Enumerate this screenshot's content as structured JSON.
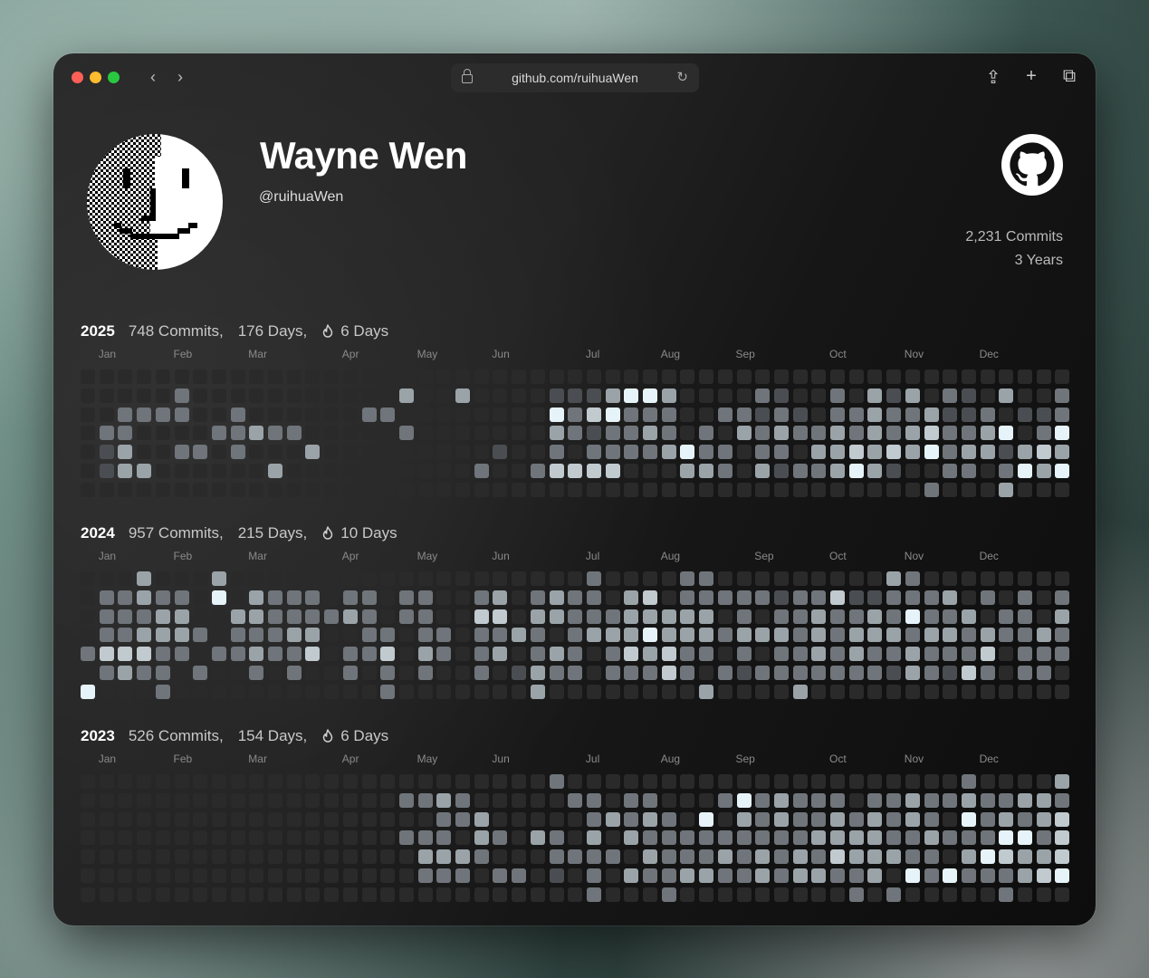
{
  "browser": {
    "url": "github.com/ruihuaWen",
    "back_icon": "chevron-left-icon",
    "forward_icon": "chevron-right-icon",
    "share_icon": "share-icon",
    "new_tab_icon": "plus-icon",
    "tabs_icon": "tabs-overview-icon"
  },
  "profile": {
    "name": "Wayne Wen",
    "handle": "@ruihuaWen",
    "commits_total": "2,231 Commits",
    "years": "3 Years"
  },
  "colors": {
    "level0": "#2a2a2a",
    "level1": "#4a4e52",
    "level2": "#6f757a",
    "level3": "#9aa3a8",
    "level4": "#c0cacf",
    "level5": "#e6f3f8"
  },
  "years": [
    {
      "year": "2025",
      "commits": "748 Commits,",
      "days": "176 Days,",
      "streak": "6 Days",
      "months": [
        "Jan",
        "Feb",
        "Mar",
        "Apr",
        "May",
        "Jun",
        "Jul",
        "Aug",
        "Sep",
        "Oct",
        "Nov",
        "Dec"
      ],
      "month_weeks": [
        1,
        5,
        9,
        14,
        18,
        22,
        27,
        31,
        35,
        40,
        44,
        48
      ],
      "levels": [
        "00000000000000000000000000000000000000000000000000000",
        "00000200000000000300300001113553000021002031302103002",
        "00222200200000022000000005245222002212102232231120112",
        "02200002232200000200000003212232020323223232342235025",
        "01300220200030000000001002022223522022033434352331343",
        "01330000003000000000020024444000332031223531002202535",
        "00000000000000000000000000000000000000000000020003000"
      ]
    },
    {
      "year": "2024",
      "commits": "957 Commits,",
      "days": "215 Days,",
      "streak": "10 Days",
      "months": [
        "Jan",
        "Feb",
        "Mar",
        "Apr",
        "May",
        "Jun",
        "Jul",
        "Aug",
        "Sep",
        "Oct",
        "Nov",
        "Dec"
      ],
      "month_weeks": [
        1,
        5,
        9,
        14,
        18,
        22,
        27,
        31,
        36,
        40,
        44,
        48
      ],
      "levels": [
        "00030003000000000000000000020000220000000003200000000",
        "02232205032220220220023023220340222221224112223020202",
        "02223300332222320220044033222333330202232232522302203",
        "02233320222330022022022320233353332333232333233232232",
        "24442202232240224032023023202434220202232322322240222",
        "02322020020200202020020132202224202122222221321420220",
        "50002000000000002000000030000000030000300000000000000"
      ]
    },
    {
      "year": "2023",
      "commits": "526 Commits,",
      "days": "154 Days,",
      "streak": "6 Days",
      "months": [
        "Jan",
        "Feb",
        "Mar",
        "Apr",
        "May",
        "Jun",
        "Jul",
        "Aug",
        "Sep",
        "Oct",
        "Nov",
        "Dec"
      ],
      "month_weeks": [
        1,
        5,
        9,
        14,
        18,
        22,
        27,
        31,
        35,
        40,
        44,
        48
      ],
      "levels": [
        "00000000000000000000000002000000000000000000000200003",
        "00000000000000000223200000220220002523222022322322332",
        "00000000000000000002230000023232050323223232320523234",
        "00000000000000000222032032030322222222233332232225524",
        "00000000000000000033320002222032223232324333220354334",
        "00000000000000000022202201020322332232332230525222345",
        "00000000000000000000000000020002000000000202000002000"
      ]
    }
  ]
}
